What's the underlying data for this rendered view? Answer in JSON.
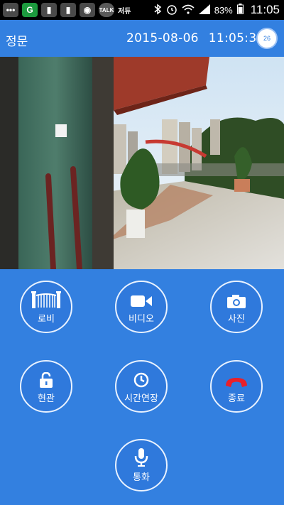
{
  "status_bar": {
    "icons": [
      "more-icon",
      "g-app-icon",
      "notice-icon",
      "notice-icon",
      "app-icon",
      "talk-icon",
      "text-icon",
      "bluetooth-icon",
      "alarm-icon",
      "wifi-icon",
      "signal-icon"
    ],
    "talk_label": "TALK",
    "app_text": "저듀",
    "battery": "83%",
    "time": "11:05"
  },
  "header": {
    "title": "정문",
    "date": "2015-08-06",
    "time": "11:05:32",
    "timer_badge": "26"
  },
  "controls": {
    "lobby": "로비",
    "video": "비디오",
    "photo": "사진",
    "entrance": "현관",
    "extend_time": "시간연장",
    "end": "종료",
    "talk": "통화"
  },
  "colors": {
    "primary": "#3380e0",
    "end_call": "#e8202a",
    "button_border": "#e9f2ff"
  }
}
